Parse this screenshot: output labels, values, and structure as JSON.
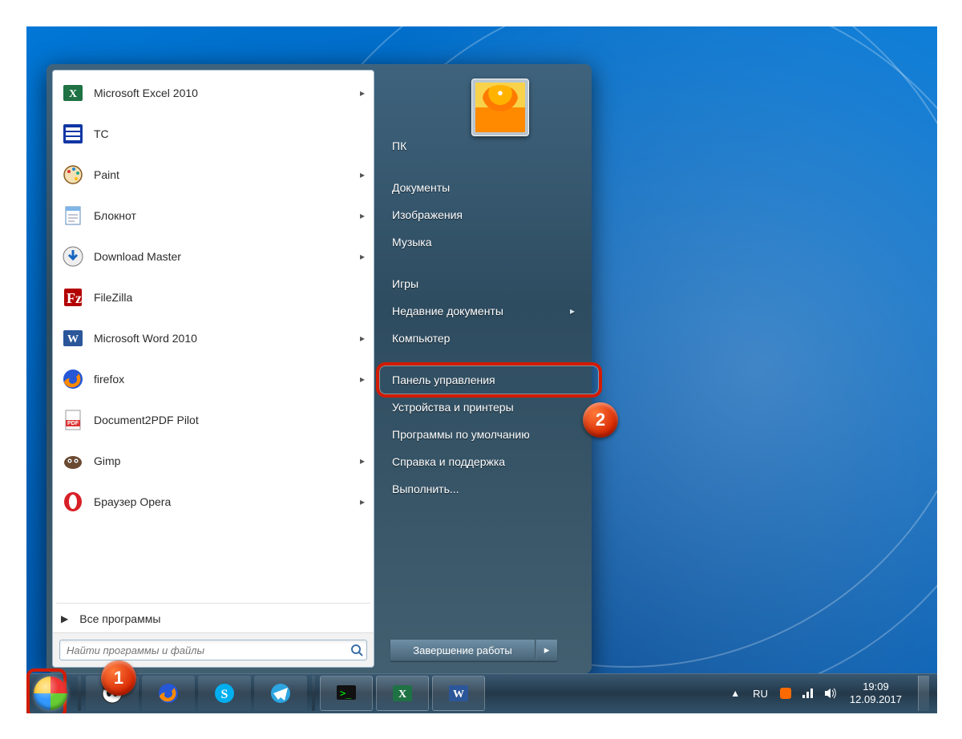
{
  "start_menu": {
    "programs": [
      {
        "label": "Microsoft Excel 2010",
        "icon": "excel-icon",
        "submenu": true
      },
      {
        "label": "TC",
        "icon": "totalcmd-icon",
        "submenu": false
      },
      {
        "label": "Paint",
        "icon": "paint-icon",
        "submenu": true
      },
      {
        "label": "Блокнот",
        "icon": "notepad-icon",
        "submenu": true
      },
      {
        "label": "Download Master",
        "icon": "dm-icon",
        "submenu": true
      },
      {
        "label": "FileZilla",
        "icon": "filezilla-icon",
        "submenu": false
      },
      {
        "label": "Microsoft Word 2010",
        "icon": "word-icon",
        "submenu": true
      },
      {
        "label": "firefox",
        "icon": "firefox-icon",
        "submenu": true
      },
      {
        "label": "Document2PDF Pilot",
        "icon": "pdf-icon",
        "submenu": false
      },
      {
        "label": "Gimp",
        "icon": "gimp-icon",
        "submenu": true
      },
      {
        "label": "Браузер Opera",
        "icon": "opera-icon",
        "submenu": true
      }
    ],
    "all_programs_label": "Все программы",
    "search_placeholder": "Найти программы и файлы",
    "nav": [
      {
        "label": "ПК",
        "submenu": false
      },
      {
        "label": "Документы",
        "submenu": false
      },
      {
        "label": "Изображения",
        "submenu": false
      },
      {
        "label": "Музыка",
        "submenu": false
      },
      {
        "label": "Игры",
        "submenu": false
      },
      {
        "label": "Недавние документы",
        "submenu": true
      },
      {
        "label": "Компьютер",
        "submenu": false
      },
      {
        "label": "Панель управления",
        "submenu": false,
        "highlight": true
      },
      {
        "label": "Устройства и принтеры",
        "submenu": false
      },
      {
        "label": "Программы по умолчанию",
        "submenu": false
      },
      {
        "label": "Справка и поддержка",
        "submenu": false
      },
      {
        "label": "Выполнить...",
        "submenu": false
      }
    ],
    "shutdown_label": "Завершение работы"
  },
  "taskbar": {
    "pinned": [
      {
        "name": "app-unknown",
        "icon": "panda-icon"
      },
      {
        "name": "app-firefox",
        "icon": "firefox-icon"
      },
      {
        "name": "app-skype",
        "icon": "skype-icon"
      },
      {
        "name": "app-telegram",
        "icon": "telegram-icon"
      }
    ],
    "running": [
      {
        "name": "app-cmd",
        "icon": "console-icon"
      },
      {
        "name": "app-excel",
        "icon": "excel-icon"
      },
      {
        "name": "app-word",
        "icon": "word-icon"
      }
    ],
    "tray_lang": "RU",
    "clock_time": "19:09",
    "clock_date": "12.09.2017"
  },
  "markers": {
    "m1": "1",
    "m2": "2"
  }
}
